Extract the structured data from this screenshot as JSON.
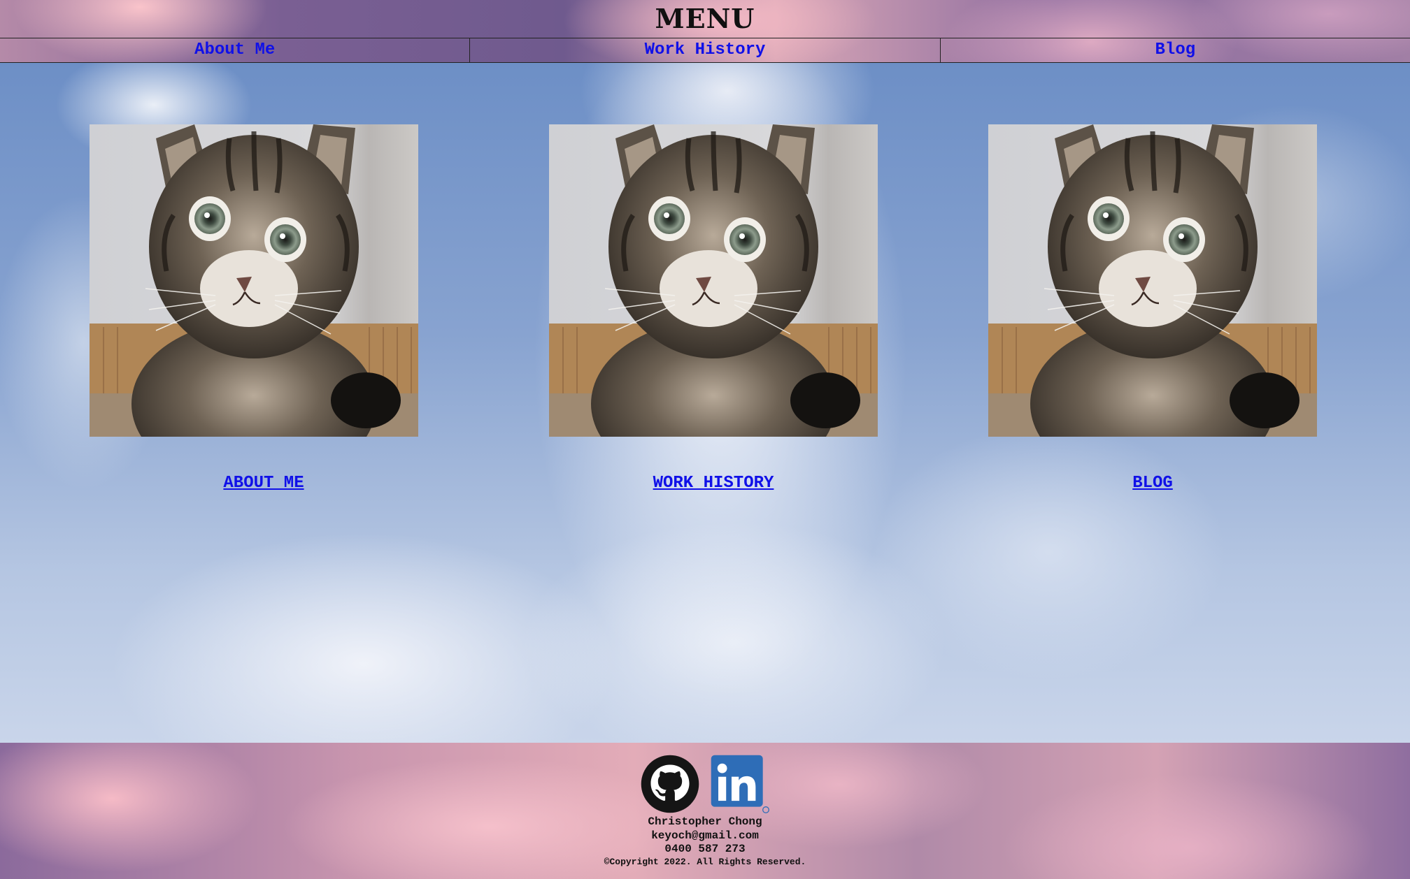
{
  "header": {
    "title": "MENU",
    "nav": [
      {
        "label": "About Me"
      },
      {
        "label": "Work History"
      },
      {
        "label": "Blog"
      }
    ]
  },
  "main": {
    "tiles": [
      {
        "image": "kitten-photo",
        "link_label": "ABOUT ME"
      },
      {
        "image": "kitten-photo",
        "link_label": "WORK HISTORY"
      },
      {
        "image": "kitten-photo",
        "link_label": "BLOG"
      }
    ]
  },
  "footer": {
    "social": [
      {
        "icon": "github-icon"
      },
      {
        "icon": "linkedin-icon",
        "color": "#2e6db7"
      }
    ],
    "name": "Christopher Chong",
    "email": "keyoch@gmail.com",
    "phone": "0400 587 273",
    "copyright": "©Copyright 2022. All Rights Reserved."
  },
  "colors": {
    "link": "#1010e8",
    "text": "#111111"
  }
}
